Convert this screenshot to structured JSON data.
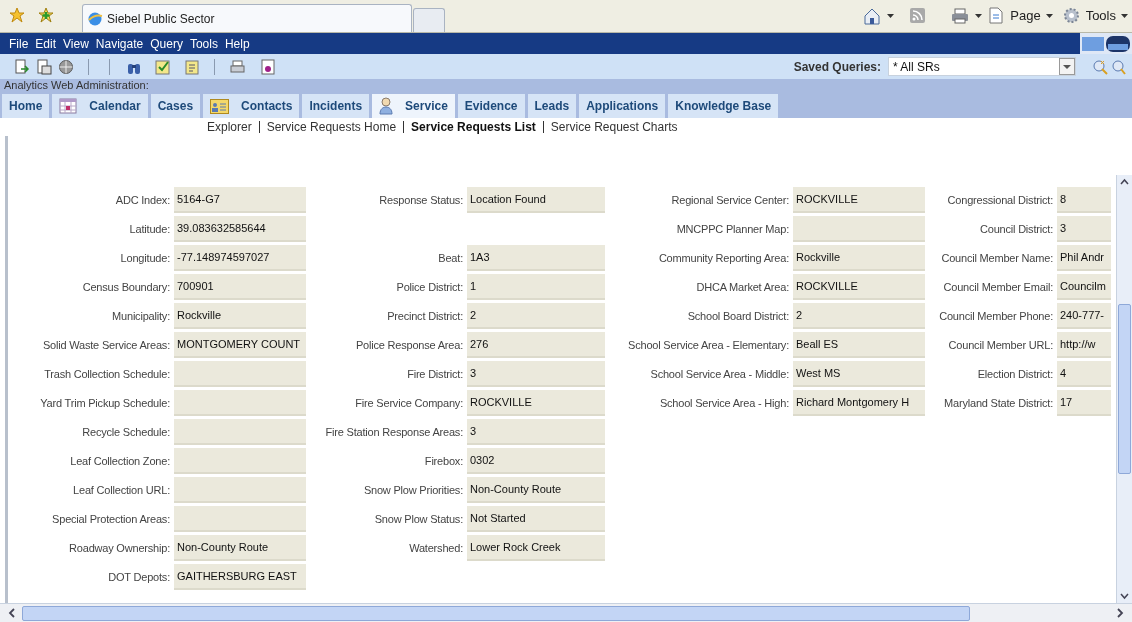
{
  "browser": {
    "tab_title": "Siebel Public Sector",
    "command_bar": [
      "Page",
      "Tools"
    ]
  },
  "menu": [
    "File",
    "Edit",
    "View",
    "Navigate",
    "Query",
    "Tools",
    "Help"
  ],
  "saved_queries": {
    "label": "Saved Queries:",
    "value": "* All SRs"
  },
  "context_label": "Analytics Web Administration:",
  "tabs": [
    {
      "label": "Home",
      "selected": false
    },
    {
      "label": "Calendar",
      "kind": "calendar",
      "selected": false
    },
    {
      "label": "Cases",
      "selected": false
    },
    {
      "label": "Contacts",
      "kind": "card",
      "selected": false
    },
    {
      "label": "Incidents",
      "selected": false
    },
    {
      "label": "Service",
      "kind": "person",
      "selected": true
    },
    {
      "label": "Evidence",
      "selected": false
    },
    {
      "label": "Leads",
      "selected": false
    },
    {
      "label": "Applications",
      "selected": false
    },
    {
      "label": "Knowledge Base",
      "selected": false
    }
  ],
  "subnav": [
    {
      "label": "Explorer",
      "selected": false
    },
    {
      "label": "Service Requests Home",
      "selected": false
    },
    {
      "label": "Service Requests List",
      "selected": true
    },
    {
      "label": "Service Request Charts",
      "selected": false
    }
  ],
  "form_rows": [
    [
      {
        "label": "ADC Index:",
        "value": "5164-G7"
      },
      {
        "label": "Response Status:",
        "value": "Location Found"
      },
      {
        "label": "Regional Service Center:",
        "value": "ROCKVILLE"
      },
      {
        "label": "Congressional District:",
        "value": "8"
      }
    ],
    [
      {
        "label": "Latitude:",
        "value": "39.083632585644"
      },
      null,
      {
        "label": "MNCPPC Planner Map:"
      },
      {
        "label": "Council District:",
        "value": "3"
      }
    ],
    [
      {
        "label": "Longitude:",
        "value": "-77.148974597027"
      },
      {
        "label": "Beat:",
        "value": "1A3"
      },
      {
        "label": "Community Reporting Area:",
        "value": "Rockville"
      },
      {
        "label": "Council Member Name:",
        "value": "Phil Andr"
      }
    ],
    [
      {
        "label": "Census Boundary:",
        "value": "700901"
      },
      {
        "label": "Police District:",
        "value": "1"
      },
      {
        "label": "DHCA Market Area:",
        "value": "ROCKVILLE"
      },
      {
        "label": "Council Member Email:",
        "value": "Councilm"
      }
    ],
    [
      {
        "label": "Municipality:",
        "value": "Rockville"
      },
      {
        "label": "Precinct District:",
        "value": "2"
      },
      {
        "label": "School Board District:",
        "value": "2"
      },
      {
        "label": "Council Member Phone:",
        "value": "240-777-"
      }
    ],
    [
      {
        "label": "Solid Waste Service Areas:",
        "value": "MONTGOMERY COUNT"
      },
      {
        "label": "Police Response Area:",
        "value": "276"
      },
      {
        "label": "School Service Area - Elementary:",
        "value": "Beall ES"
      },
      {
        "label": "Council Member URL:",
        "value": "http://w"
      }
    ],
    [
      {
        "label": "Trash Collection Schedule:"
      },
      {
        "label": "Fire District:",
        "value": "3"
      },
      {
        "label": "School Service Area - Middle:",
        "value": "West MS"
      },
      {
        "label": "Election District:",
        "value": "4"
      }
    ],
    [
      {
        "label": "Yard Trim Pickup Schedule:"
      },
      {
        "label": "Fire Service Company:",
        "value": "ROCKVILLE"
      },
      {
        "label": "School Service Area - High:",
        "value": "Richard Montgomery H"
      },
      {
        "label": "Maryland State District:",
        "value": "17"
      }
    ],
    [
      {
        "label": "Recycle Schedule:"
      },
      {
        "label": "Fire Station Response Areas:",
        "value": "3"
      }
    ],
    [
      {
        "label": "Leaf Collection Zone:"
      },
      {
        "label": "Firebox:",
        "value": "0302"
      }
    ],
    [
      {
        "label": "Leaf Collection URL:"
      },
      {
        "label": "Snow Plow Priorities:",
        "value": "Non-County Route"
      }
    ],
    [
      {
        "label": "Special Protection Areas:"
      },
      {
        "label": "Snow Plow Status:",
        "value": "Not Started"
      }
    ],
    [
      {
        "label": "Roadway Ownership:",
        "value": "Non-County Route"
      },
      {
        "label": "Watershed:",
        "value": "Lower Rock Creek"
      }
    ],
    [
      {
        "label": "DOT Depots:",
        "value": "GAITHERSBURG EAST"
      }
    ]
  ]
}
